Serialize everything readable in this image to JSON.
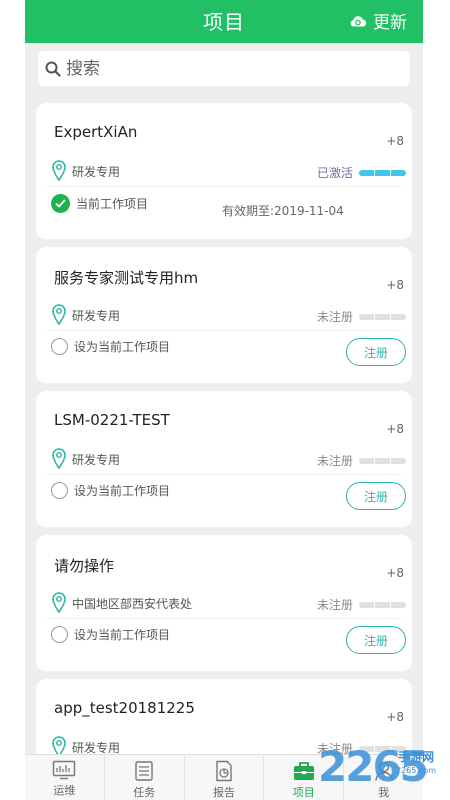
{
  "header": {
    "title": "项目",
    "refresh_label": "更新",
    "bg_color": "#22c064"
  },
  "search": {
    "placeholder": "搜索"
  },
  "projects": [
    {
      "name": "ExpertXiAn",
      "count": "+8",
      "location": "研发专用",
      "status": "已激活",
      "work_label": "当前工作项目",
      "is_current": true,
      "expiry": "有效期至:2019-11-04"
    },
    {
      "name": "服务专家测试专用hm",
      "count": "+8",
      "location": "研发专用",
      "status": "未注册",
      "work_label": "设为当前工作项目",
      "register_label": "注册"
    },
    {
      "name": "LSM-0221-TEST",
      "count": "+8",
      "location": "研发专用",
      "status": "未注册",
      "work_label": "设为当前工作项目",
      "register_label": "注册"
    },
    {
      "name": "请勿操作",
      "count": "+8",
      "location": "中国地区部西安代表处",
      "status": "未注册",
      "work_label": "设为当前工作项目",
      "register_label": "注册"
    },
    {
      "name": "app_test20181225",
      "count": "+8",
      "location": "研发专用",
      "status": "未注册"
    }
  ],
  "tabs": [
    {
      "label": "运维",
      "icon": "monitor-icon",
      "active": false
    },
    {
      "label": "任务",
      "icon": "clipboard-icon",
      "active": false
    },
    {
      "label": "报告",
      "icon": "report-icon",
      "active": false
    },
    {
      "label": "项目",
      "icon": "toolbox-icon",
      "active": true
    },
    {
      "label": "我",
      "icon": "person-icon",
      "active": false
    }
  ],
  "watermark": {
    "logo_text": "2265",
    "sub_text": "手游网",
    "url_text": "2265.com"
  }
}
